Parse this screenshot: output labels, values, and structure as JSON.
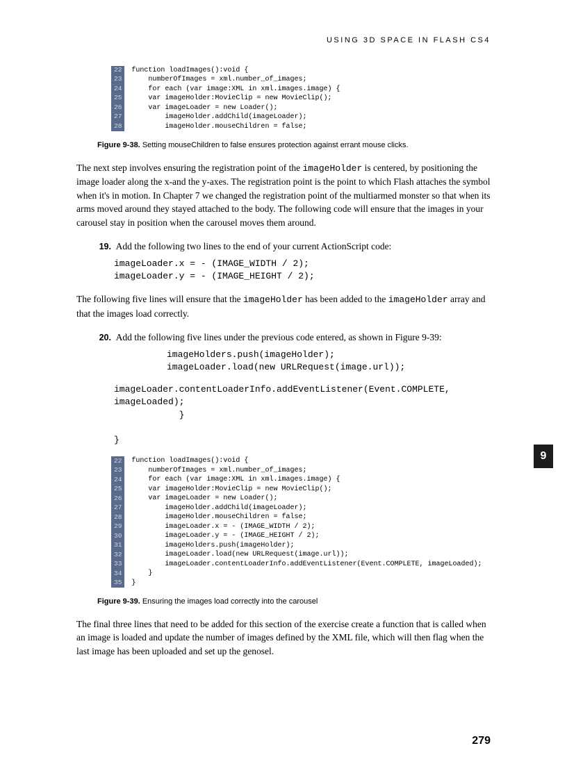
{
  "header": "USING 3D SPACE IN FLASH CS4",
  "figure_938": {
    "lines": [
      {
        "n": "22",
        "c": "function loadImages():void {"
      },
      {
        "n": "23",
        "c": "    numberOfImages = xml.number_of_images;"
      },
      {
        "n": "24",
        "c": "    for each (var image:XML in xml.images.image) {"
      },
      {
        "n": "25",
        "c": "    var imageHolder:MovieClip = new MovieClip();"
      },
      {
        "n": "26",
        "c": "    var imageLoader = new Loader();"
      },
      {
        "n": "27",
        "c": "        imageHolder.addChild(imageLoader);"
      },
      {
        "n": "28",
        "c": "        imageHolder.mouseChildren = false;"
      }
    ],
    "label": "Figure 9-38.",
    "caption": "Setting mouseChildren to false ensures protection against errant mouse clicks."
  },
  "para1_a": "The next step involves ensuring the registration point of the ",
  "para1_code": "imageHolder",
  "para1_b": " is centered, by positioning the image loader along the x-and the y-axes. The registration point is the point to which Flash attaches the symbol when it's in motion. In Chapter 7 we changed the registration point of the multiarmed monster so that when its arms moved around they stayed attached to the body. The following code will ensure that the images in your carousel stay in position when the carousel moves them around.",
  "step19": {
    "num": "19.",
    "text": "Add the following two lines to the end of your current ActionScript code:",
    "code": "imageLoader.x = - (IMAGE_WIDTH / 2);\nimageLoader.y = - (IMAGE_HEIGHT / 2);"
  },
  "para2_a": "The following five lines will ensure that the ",
  "para2_c1": "imageHolder",
  "para2_b": " has been added to the ",
  "para2_c2": "imageHolder",
  "para2_c": " array and that the images load correctly.",
  "step20": {
    "num": "20.",
    "text": "Add the following five lines under the previous code entered, as shown in Figure 9-39:",
    "code_a": "imageHolders.push(imageHolder);\nimageLoader.load(new URLRequest(image.url));",
    "code_b": "imageLoader.contentLoaderInfo.addEventListener(Event.COMPLETE,\nimageLoaded);\n            }\n\n}"
  },
  "figure_939": {
    "lines": [
      {
        "n": "22",
        "c": "function loadImages():void {"
      },
      {
        "n": "23",
        "c": "    numberOfImages = xml.number_of_images;"
      },
      {
        "n": "24",
        "c": "    for each (var image:XML in xml.images.image) {"
      },
      {
        "n": "25",
        "c": "    var imageHolder:MovieClip = new MovieClip();"
      },
      {
        "n": "26",
        "c": "    var imageLoader = new Loader();"
      },
      {
        "n": "27",
        "c": "        imageHolder.addChild(imageLoader);"
      },
      {
        "n": "28",
        "c": "        imageHolder.mouseChildren = false;"
      },
      {
        "n": "29",
        "c": "        imageLoader.x = - (IMAGE_WIDTH / 2);"
      },
      {
        "n": "30",
        "c": "        imageLoader.y = - (IMAGE_HEIGHT / 2);"
      },
      {
        "n": "31",
        "c": "        imageHolders.push(imageHolder);"
      },
      {
        "n": "32",
        "c": "        imageLoader.load(new URLRequest(image.url));"
      },
      {
        "n": "33",
        "c": "        imageLoader.contentLoaderInfo.addEventListener(Event.COMPLETE, imageLoaded);"
      },
      {
        "n": "34",
        "c": "    }"
      },
      {
        "n": "35",
        "c": "}"
      }
    ],
    "label": "Figure 9-39.",
    "caption": "Ensuring the images load correctly into the carousel"
  },
  "para3": "The final three lines that need to be added for this section of the exercise create a function that is called when an image is loaded and update the number of images defined by the XML file, which will then flag when the last image has been uploaded and set up the genosel.",
  "side_tab": "9",
  "page_num": "279"
}
